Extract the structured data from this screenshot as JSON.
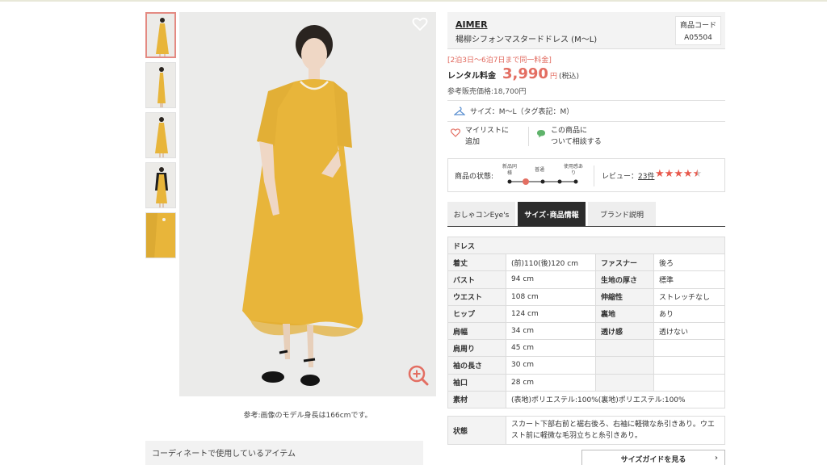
{
  "product": {
    "brand": "AIMER",
    "name": "楊柳シフォンマスタードドレス (M〜L)",
    "code_label": "商品コード",
    "code": "A05504",
    "same_price_note": "[2泊3日〜6泊7日まで同一料金]",
    "price_label": "レンタル料金",
    "price": "3,990",
    "price_unit": "円",
    "price_tax": "(税込)",
    "ref_price": "参考販売価格:18,700円",
    "size_text": "サイズ：M〜L（タグ表記：M）",
    "mylist_line1": "マイリストに",
    "mylist_line2": "追加",
    "consult_line1": "この商品に",
    "consult_line2": "ついて相談する",
    "condition_label": "商品の状態:",
    "condition_scale": [
      "新品同様",
      "普通",
      "使用感あり"
    ],
    "review_label": "レビュー：",
    "review_count": "23件",
    "rating": 4.5,
    "model_caption": "参考:画像のモデル身長は166cmです。",
    "coord_heading": "コーディネートで使用しているアイテム",
    "colors": {
      "accent": "#e36e62",
      "dress": "#e8b53a",
      "tab_active": "#2c2c2c"
    }
  },
  "tabs": [
    {
      "label": "おしゃコンEye's",
      "active": false
    },
    {
      "label": "サイズ･商品情報",
      "active": true
    },
    {
      "label": "ブランド説明",
      "active": false
    }
  ],
  "spec": {
    "heading": "ドレス",
    "rows": [
      {
        "k1": "着丈",
        "v1": "(前)110(後)120 cm",
        "k2": "ファスナー",
        "v2": "後ろ"
      },
      {
        "k1": "バスト",
        "v1": "94 cm",
        "k2": "生地の厚さ",
        "v2": "標準"
      },
      {
        "k1": "ウエスト",
        "v1": "108 cm",
        "k2": "伸縮性",
        "v2": "ストレッチなし"
      },
      {
        "k1": "ヒップ",
        "v1": "124 cm",
        "k2": "裏地",
        "v2": "あり"
      },
      {
        "k1": "肩幅",
        "v1": "34 cm",
        "k2": "透け感",
        "v2": "透けない"
      },
      {
        "k1": "肩周り",
        "v1": "45 cm",
        "k2": "",
        "v2": ""
      },
      {
        "k1": "袖の長さ",
        "v1": "30 cm",
        "k2": "",
        "v2": ""
      },
      {
        "k1": "袖口",
        "v1": "28 cm",
        "k2": "",
        "v2": ""
      }
    ],
    "material_label": "素材",
    "material": "(表地)ポリエステル:100%(裏地)ポリエステル:100%",
    "state_label": "状態",
    "state": "スカート下部右前と裾右後ろ、右袖に軽微な糸引きあり。ウエスト前に軽微な毛羽立ちと糸引きあり。"
  },
  "size_guide_label": "サイズガイドを見る"
}
